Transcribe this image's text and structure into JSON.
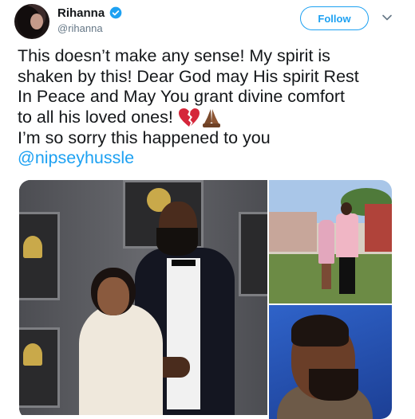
{
  "user": {
    "display_name": "Rihanna",
    "handle": "@rihanna",
    "verified": true,
    "verified_color": "#1da1f2"
  },
  "actions": {
    "follow_label": "Follow",
    "menu_icon": "chevron-down-icon"
  },
  "tweet": {
    "lines": [
      "This doesn’t make any sense! My spirit is",
      "shaken by this! Dear God may His spirit Rest",
      "In Peace and May You grant divine comfort",
      "to all his loved ones!",
      "I’m so sorry this happened to you"
    ],
    "mention": "@nipseyhussle",
    "emojis": [
      "broken-heart-emoji",
      "folded-hands-emoji"
    ]
  },
  "media": {
    "count": 3,
    "images": [
      "photo-red-carpet",
      "photo-garden-couple",
      "photo-portrait"
    ]
  },
  "colors": {
    "accent": "#1da1f2",
    "text": "#14171a",
    "secondary_text": "#657786"
  }
}
